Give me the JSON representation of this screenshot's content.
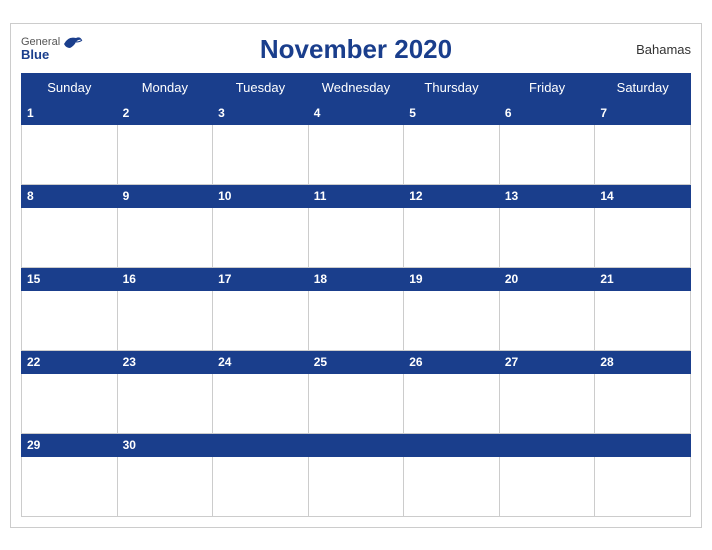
{
  "header": {
    "logo_general": "General",
    "logo_blue": "Blue",
    "title": "November 2020",
    "country": "Bahamas"
  },
  "days_of_week": [
    "Sunday",
    "Monday",
    "Tuesday",
    "Wednesday",
    "Thursday",
    "Friday",
    "Saturday"
  ],
  "weeks": [
    {
      "dates": [
        1,
        2,
        3,
        4,
        5,
        6,
        7
      ]
    },
    {
      "dates": [
        8,
        9,
        10,
        11,
        12,
        13,
        14
      ]
    },
    {
      "dates": [
        15,
        16,
        17,
        18,
        19,
        20,
        21
      ]
    },
    {
      "dates": [
        22,
        23,
        24,
        25,
        26,
        27,
        28
      ]
    },
    {
      "dates": [
        29,
        30,
        null,
        null,
        null,
        null,
        null
      ]
    }
  ],
  "colors": {
    "header_bg": "#1a3e8c",
    "header_text": "#ffffff",
    "day_number": "#1a3e8c",
    "num_row_bg": "#1a3e8c",
    "border": "#ccc"
  }
}
